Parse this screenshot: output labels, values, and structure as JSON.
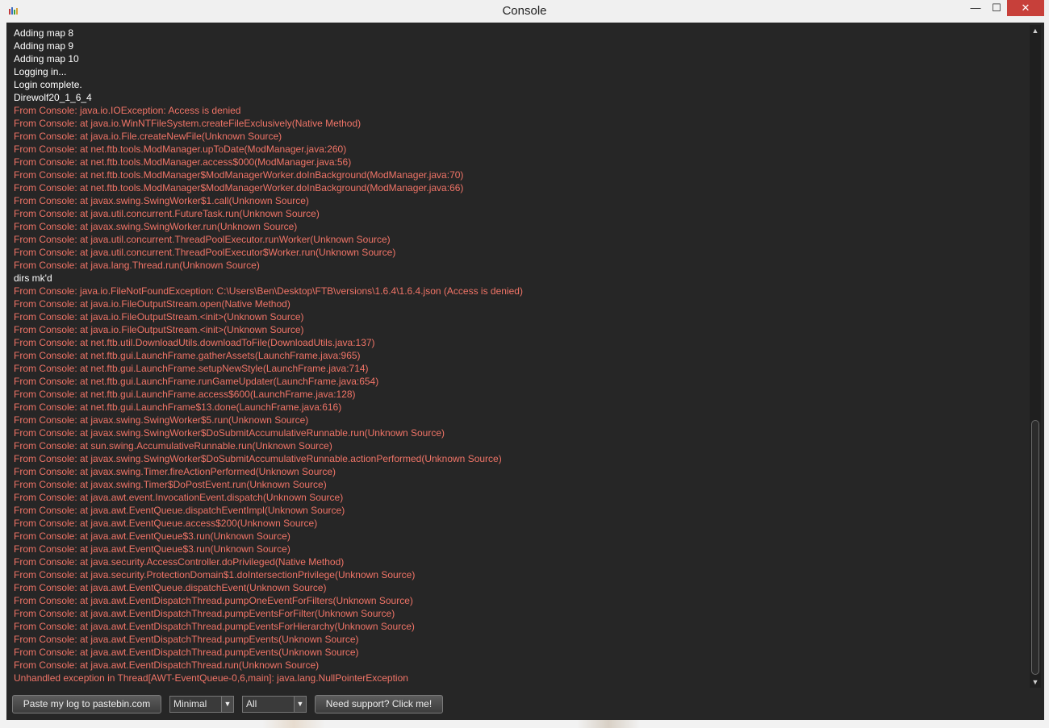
{
  "window": {
    "title": "Console",
    "controls": {
      "minimize": "—",
      "maximize": "☐",
      "close": "✕"
    }
  },
  "colors": {
    "normal_text": "#ffffff",
    "error_text": "#f07467",
    "background": "#262626"
  },
  "log": {
    "lines": [
      {
        "text": "Adding map 8",
        "level": "normal"
      },
      {
        "text": "Adding map 9",
        "level": "normal"
      },
      {
        "text": "Adding map 10",
        "level": "normal"
      },
      {
        "text": "Logging in...",
        "level": "normal"
      },
      {
        "text": "Login complete.",
        "level": "normal"
      },
      {
        "text": "Direwolf20_1_6_4",
        "level": "normal"
      },
      {
        "text": "From Console: java.io.IOException: Access is denied",
        "level": "error"
      },
      {
        "text": "From Console: at java.io.WinNTFileSystem.createFileExclusively(Native Method)",
        "level": "error"
      },
      {
        "text": "From Console: at java.io.File.createNewFile(Unknown Source)",
        "level": "error"
      },
      {
        "text": "From Console: at net.ftb.tools.ModManager.upToDate(ModManager.java:260)",
        "level": "error"
      },
      {
        "text": "From Console: at net.ftb.tools.ModManager.access$000(ModManager.java:56)",
        "level": "error"
      },
      {
        "text": "From Console: at net.ftb.tools.ModManager$ModManagerWorker.doInBackground(ModManager.java:70)",
        "level": "error"
      },
      {
        "text": "From Console: at net.ftb.tools.ModManager$ModManagerWorker.doInBackground(ModManager.java:66)",
        "level": "error"
      },
      {
        "text": "From Console: at javax.swing.SwingWorker$1.call(Unknown Source)",
        "level": "error"
      },
      {
        "text": "From Console: at java.util.concurrent.FutureTask.run(Unknown Source)",
        "level": "error"
      },
      {
        "text": "From Console: at javax.swing.SwingWorker.run(Unknown Source)",
        "level": "error"
      },
      {
        "text": "From Console: at java.util.concurrent.ThreadPoolExecutor.runWorker(Unknown Source)",
        "level": "error"
      },
      {
        "text": "From Console: at java.util.concurrent.ThreadPoolExecutor$Worker.run(Unknown Source)",
        "level": "error"
      },
      {
        "text": "From Console: at java.lang.Thread.run(Unknown Source)",
        "level": "error"
      },
      {
        "text": "dirs mk'd",
        "level": "normal"
      },
      {
        "text": "From Console: java.io.FileNotFoundException: C:\\Users\\Ben\\Desktop\\FTB\\versions\\1.6.4\\1.6.4.json (Access is denied)",
        "level": "error"
      },
      {
        "text": "From Console: at java.io.FileOutputStream.open(Native Method)",
        "level": "error"
      },
      {
        "text": "From Console: at java.io.FileOutputStream.<init>(Unknown Source)",
        "level": "error"
      },
      {
        "text": "From Console: at java.io.FileOutputStream.<init>(Unknown Source)",
        "level": "error"
      },
      {
        "text": "From Console: at net.ftb.util.DownloadUtils.downloadToFile(DownloadUtils.java:137)",
        "level": "error"
      },
      {
        "text": "From Console: at net.ftb.gui.LaunchFrame.gatherAssets(LaunchFrame.java:965)",
        "level": "error"
      },
      {
        "text": "From Console: at net.ftb.gui.LaunchFrame.setupNewStyle(LaunchFrame.java:714)",
        "level": "error"
      },
      {
        "text": "From Console: at net.ftb.gui.LaunchFrame.runGameUpdater(LaunchFrame.java:654)",
        "level": "error"
      },
      {
        "text": "From Console: at net.ftb.gui.LaunchFrame.access$600(LaunchFrame.java:128)",
        "level": "error"
      },
      {
        "text": "From Console: at net.ftb.gui.LaunchFrame$13.done(LaunchFrame.java:616)",
        "level": "error"
      },
      {
        "text": "From Console: at javax.swing.SwingWorker$5.run(Unknown Source)",
        "level": "error"
      },
      {
        "text": "From Console: at javax.swing.SwingWorker$DoSubmitAccumulativeRunnable.run(Unknown Source)",
        "level": "error"
      },
      {
        "text": "From Console: at sun.swing.AccumulativeRunnable.run(Unknown Source)",
        "level": "error"
      },
      {
        "text": "From Console: at javax.swing.SwingWorker$DoSubmitAccumulativeRunnable.actionPerformed(Unknown Source)",
        "level": "error"
      },
      {
        "text": "From Console: at javax.swing.Timer.fireActionPerformed(Unknown Source)",
        "level": "error"
      },
      {
        "text": "From Console: at javax.swing.Timer$DoPostEvent.run(Unknown Source)",
        "level": "error"
      },
      {
        "text": "From Console: at java.awt.event.InvocationEvent.dispatch(Unknown Source)",
        "level": "error"
      },
      {
        "text": "From Console: at java.awt.EventQueue.dispatchEventImpl(Unknown Source)",
        "level": "error"
      },
      {
        "text": "From Console: at java.awt.EventQueue.access$200(Unknown Source)",
        "level": "error"
      },
      {
        "text": "From Console: at java.awt.EventQueue$3.run(Unknown Source)",
        "level": "error"
      },
      {
        "text": "From Console: at java.awt.EventQueue$3.run(Unknown Source)",
        "level": "error"
      },
      {
        "text": "From Console: at java.security.AccessController.doPrivileged(Native Method)",
        "level": "error"
      },
      {
        "text": "From Console: at java.security.ProtectionDomain$1.doIntersectionPrivilege(Unknown Source)",
        "level": "error"
      },
      {
        "text": "From Console: at java.awt.EventQueue.dispatchEvent(Unknown Source)",
        "level": "error"
      },
      {
        "text": "From Console: at java.awt.EventDispatchThread.pumpOneEventForFilters(Unknown Source)",
        "level": "error"
      },
      {
        "text": "From Console: at java.awt.EventDispatchThread.pumpEventsForFilter(Unknown Source)",
        "level": "error"
      },
      {
        "text": "From Console: at java.awt.EventDispatchThread.pumpEventsForHierarchy(Unknown Source)",
        "level": "error"
      },
      {
        "text": "From Console: at java.awt.EventDispatchThread.pumpEvents(Unknown Source)",
        "level": "error"
      },
      {
        "text": "From Console: at java.awt.EventDispatchThread.pumpEvents(Unknown Source)",
        "level": "error"
      },
      {
        "text": "From Console: at java.awt.EventDispatchThread.run(Unknown Source)",
        "level": "error"
      },
      {
        "text": "Unhandled exception in Thread[AWT-EventQueue-0,6,main]: java.lang.NullPointerException",
        "level": "error"
      }
    ]
  },
  "scrollbar": {
    "up_arrow": "▲",
    "down_arrow": "▼",
    "thumb_start_fraction": 0.6,
    "thumb_size_fraction": 0.4
  },
  "toolbar": {
    "pastebin_label": "Paste my log to pastebin.com",
    "log_level_value": "Minimal",
    "log_source_value": "All",
    "combo_arrow": "▼",
    "support_label": "Need support? Click me!"
  }
}
